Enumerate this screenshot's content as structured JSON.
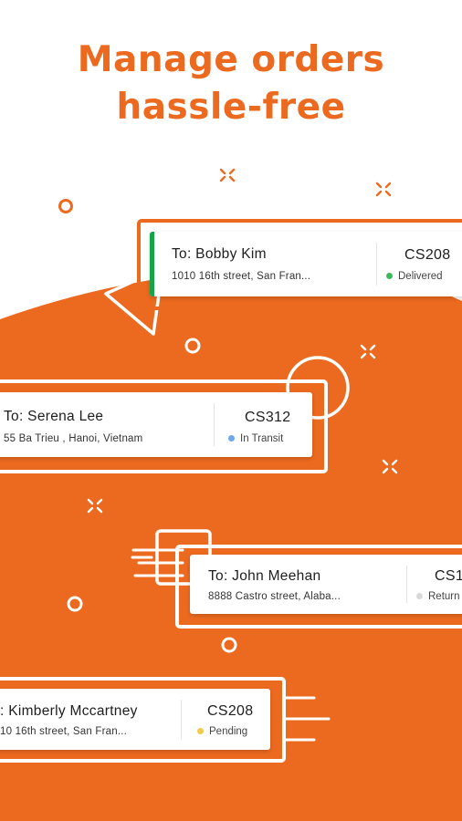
{
  "headline": {
    "line1": "Manage orders",
    "line2": "hassle-free"
  },
  "colors": {
    "brand": "#ec6a1f",
    "delivered": "#3cb95a",
    "in_transit": "#6fa8ee",
    "returned": "#d9d9d9",
    "pending": "#f3c94c",
    "delivered_accent": "#16a34a"
  },
  "orders": [
    {
      "to": "To: Bobby Kim",
      "address": "1010 16th street, San Fran...",
      "code": "CS208",
      "status": "Delivered",
      "status_color": "#3cb95a"
    },
    {
      "to": "To: Serena Lee",
      "address": "55 Ba Trieu , Hanoi, Vietnam",
      "code": "CS312",
      "status": "In Transit",
      "status_color": "#6fa8ee"
    },
    {
      "to": "To: John Meehan",
      "address": "8888 Castro street, Alaba...",
      "code": "CS1",
      "status": "Return",
      "status_color": "#d9d9d9"
    },
    {
      "to": ": Kimberly Mccartney",
      "address": "10 16th street, San Fran...",
      "code": "CS208",
      "status": "Pending",
      "status_color": "#f3c94c"
    }
  ]
}
